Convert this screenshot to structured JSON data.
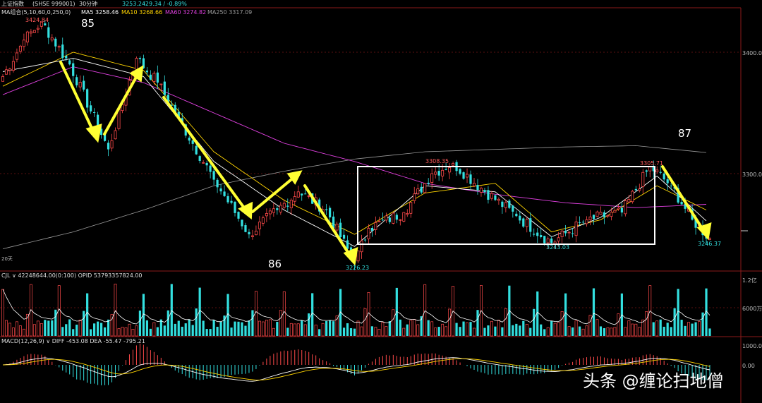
{
  "header": {
    "index_name": "上证指数",
    "index_code": "(SHSE 999001)",
    "period": "30分钟",
    "price": "3253.24",
    "change": "-29.34 / -0.89%"
  },
  "ma_legend": {
    "label": "MA组合(5,10,60,0,250,0)",
    "items": [
      {
        "text": "MA5 3258.46",
        "color": "#ffffff"
      },
      {
        "text": "MA10 3268.66",
        "color": "#ffd400"
      },
      {
        "text": "MA60 3274.82",
        "color": "#e040e0"
      },
      {
        "text": "MA250 3317.09",
        "color": "#9a9a9a"
      }
    ]
  },
  "price_axis": {
    "ticks": [
      {
        "value": 3400,
        "label": "3400.00"
      },
      {
        "value": 3300,
        "label": "3300.00"
      }
    ]
  },
  "annotations": {
    "wave_labels": [
      {
        "text": "85"
      },
      {
        "text": "86"
      },
      {
        "text": "87"
      }
    ],
    "price_marks": [
      {
        "text": "3424.84",
        "color": "#ff5a5a"
      },
      {
        "text": "3226.23",
        "color": "#33e0e0"
      },
      {
        "text": "3308.35",
        "color": "#ff5a5a"
      },
      {
        "text": "3305.71",
        "color": "#ff5a5a"
      },
      {
        "text": "3243.03",
        "color": "#33e0e0"
      },
      {
        "text": "3246.37",
        "color": "#33e0e0"
      }
    ],
    "days_label": "20天"
  },
  "volume_panel": {
    "header": "CJL ∨  42248644.00(0:100)  OPID 53793357824.00",
    "axis_labels": [
      "1.2亿",
      "6000万"
    ]
  },
  "macd_panel": {
    "header": "MACD(12,26,9) ∨  DIFF -453.08  DEA -55.47  -795.21",
    "axis_labels": [
      "1000.00",
      "0.00"
    ]
  },
  "watermark": "头条 @缠论扫地僧",
  "colors": {
    "up": "#ff4a4a",
    "down": "#33e0e0",
    "arrow": "#ffff33",
    "box": "#ffffff",
    "ma5": "#ffffff",
    "ma10": "#ffd400",
    "ma60": "#e040e0",
    "ma250": "#9a9a9a"
  },
  "chart_data": {
    "type": "candlestick",
    "title": "上证指数 30分钟",
    "price_ylim": [
      3210,
      3460
    ],
    "close_path": [
      {
        "bar": 0,
        "price": 3380
      },
      {
        "bar": 6,
        "price": 3410
      },
      {
        "bar": 11,
        "price": 3424.84
      },
      {
        "bar": 19,
        "price": 3390
      },
      {
        "bar": 30,
        "price": 3320
      },
      {
        "bar": 38,
        "price": 3395
      },
      {
        "bar": 44,
        "price": 3375
      },
      {
        "bar": 50,
        "price": 3345
      },
      {
        "bar": 60,
        "price": 3295
      },
      {
        "bar": 70,
        "price": 3250
      },
      {
        "bar": 78,
        "price": 3270
      },
      {
        "bar": 84,
        "price": 3285
      },
      {
        "bar": 92,
        "price": 3270
      },
      {
        "bar": 100,
        "price": 3226.23
      },
      {
        "bar": 104,
        "price": 3255
      },
      {
        "bar": 114,
        "price": 3268
      },
      {
        "bar": 122,
        "price": 3300
      },
      {
        "bar": 128,
        "price": 3308.35
      },
      {
        "bar": 136,
        "price": 3288
      },
      {
        "bar": 146,
        "price": 3265
      },
      {
        "bar": 156,
        "price": 3243.03
      },
      {
        "bar": 166,
        "price": 3262
      },
      {
        "bar": 176,
        "price": 3268
      },
      {
        "bar": 184,
        "price": 3305.71
      },
      {
        "bar": 190,
        "price": 3290
      },
      {
        "bar": 196,
        "price": 3262
      },
      {
        "bar": 201,
        "price": 3246.37
      }
    ],
    "ma5": [
      {
        "bar": 0,
        "price": 3384
      },
      {
        "bar": 20,
        "price": 3395
      },
      {
        "bar": 40,
        "price": 3380
      },
      {
        "bar": 60,
        "price": 3310
      },
      {
        "bar": 80,
        "price": 3270
      },
      {
        "bar": 100,
        "price": 3240
      },
      {
        "bar": 120,
        "price": 3290
      },
      {
        "bar": 140,
        "price": 3285
      },
      {
        "bar": 156,
        "price": 3248
      },
      {
        "bar": 170,
        "price": 3264
      },
      {
        "bar": 186,
        "price": 3298
      },
      {
        "bar": 201,
        "price": 3258.46
      }
    ],
    "ma10": [
      {
        "bar": 0,
        "price": 3372
      },
      {
        "bar": 20,
        "price": 3400
      },
      {
        "bar": 40,
        "price": 3385
      },
      {
        "bar": 60,
        "price": 3318
      },
      {
        "bar": 80,
        "price": 3278
      },
      {
        "bar": 100,
        "price": 3250
      },
      {
        "bar": 120,
        "price": 3284
      },
      {
        "bar": 140,
        "price": 3292
      },
      {
        "bar": 156,
        "price": 3252
      },
      {
        "bar": 170,
        "price": 3262
      },
      {
        "bar": 186,
        "price": 3290
      },
      {
        "bar": 201,
        "price": 3268.66
      }
    ],
    "ma60": [
      {
        "bar": 0,
        "price": 3365
      },
      {
        "bar": 20,
        "price": 3388
      },
      {
        "bar": 40,
        "price": 3375
      },
      {
        "bar": 60,
        "price": 3350
      },
      {
        "bar": 80,
        "price": 3325
      },
      {
        "bar": 100,
        "price": 3310
      },
      {
        "bar": 120,
        "price": 3292
      },
      {
        "bar": 140,
        "price": 3283
      },
      {
        "bar": 160,
        "price": 3276
      },
      {
        "bar": 180,
        "price": 3272
      },
      {
        "bar": 201,
        "price": 3274.82
      }
    ],
    "ma250": [
      {
        "bar": 0,
        "price": 3238
      },
      {
        "bar": 20,
        "price": 3252
      },
      {
        "bar": 40,
        "price": 3270
      },
      {
        "bar": 60,
        "price": 3290
      },
      {
        "bar": 80,
        "price": 3302
      },
      {
        "bar": 100,
        "price": 3312
      },
      {
        "bar": 120,
        "price": 3318
      },
      {
        "bar": 140,
        "price": 3320
      },
      {
        "bar": 160,
        "price": 3322
      },
      {
        "bar": 180,
        "price": 3323
      },
      {
        "bar": 201,
        "price": 3317.09
      }
    ]
  }
}
